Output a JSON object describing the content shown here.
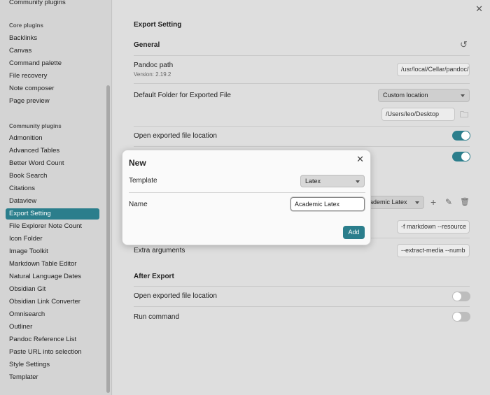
{
  "sidebar": {
    "top_cut_item": "Community plugins",
    "core_heading": "Core plugins",
    "core_items": [
      "Backlinks",
      "Canvas",
      "Command palette",
      "File recovery",
      "Note composer",
      "Page preview"
    ],
    "community_heading": "Community plugins",
    "community_items": [
      "Admonition",
      "Advanced Tables",
      "Better Word Count",
      "Book Search",
      "Citations",
      "Dataview",
      "Export Setting",
      "File Explorer Note Count",
      "Icon Folder",
      "Image Toolkit",
      "Markdown Table Editor",
      "Natural Language Dates",
      "Obsidian Git",
      "Obsidian Link Converter",
      "Omnisearch",
      "Outliner",
      "Pandoc Reference List",
      "Paste URL into selection",
      "Style Settings",
      "Templater"
    ],
    "active_item": "Export Setting"
  },
  "main": {
    "close_icon": "✕",
    "title": "Export Setting",
    "general_heading": "General",
    "reset_icon": "↺",
    "pandoc_path_label": "Pandoc path",
    "pandoc_version": "Version: 2.19.2",
    "pandoc_path_value": "/usr/local/Cellar/pandoc/",
    "default_folder_label": "Default Folder for Exported File",
    "default_folder_select": "Custom location",
    "custom_folder_value": "/Users/leo/Desktop",
    "folder_icon": "🗀",
    "open_exported_label": "Open exported file location",
    "open_exported_on": true,
    "second_toggle_on": true,
    "template_select_visible": "ademic Latex",
    "add_icon": "+",
    "edit_icon": "✎",
    "delete_icon": "🗑",
    "args_value_1": "-f markdown --resource",
    "extra_arguments_label": "Extra arguments",
    "extra_arguments_value": "--extract-media --numb",
    "after_export_heading": "After Export",
    "after_open_label": "Open exported file location",
    "after_open_on": false,
    "run_command_label": "Run command",
    "run_command_on": false
  },
  "modal": {
    "title": "New",
    "close_icon": "✕",
    "template_label": "Template",
    "template_value": "Latex",
    "name_label": "Name",
    "name_value": "Academic Latex",
    "add_label": "Add"
  },
  "colors": {
    "accent": "#2b7e8c"
  }
}
